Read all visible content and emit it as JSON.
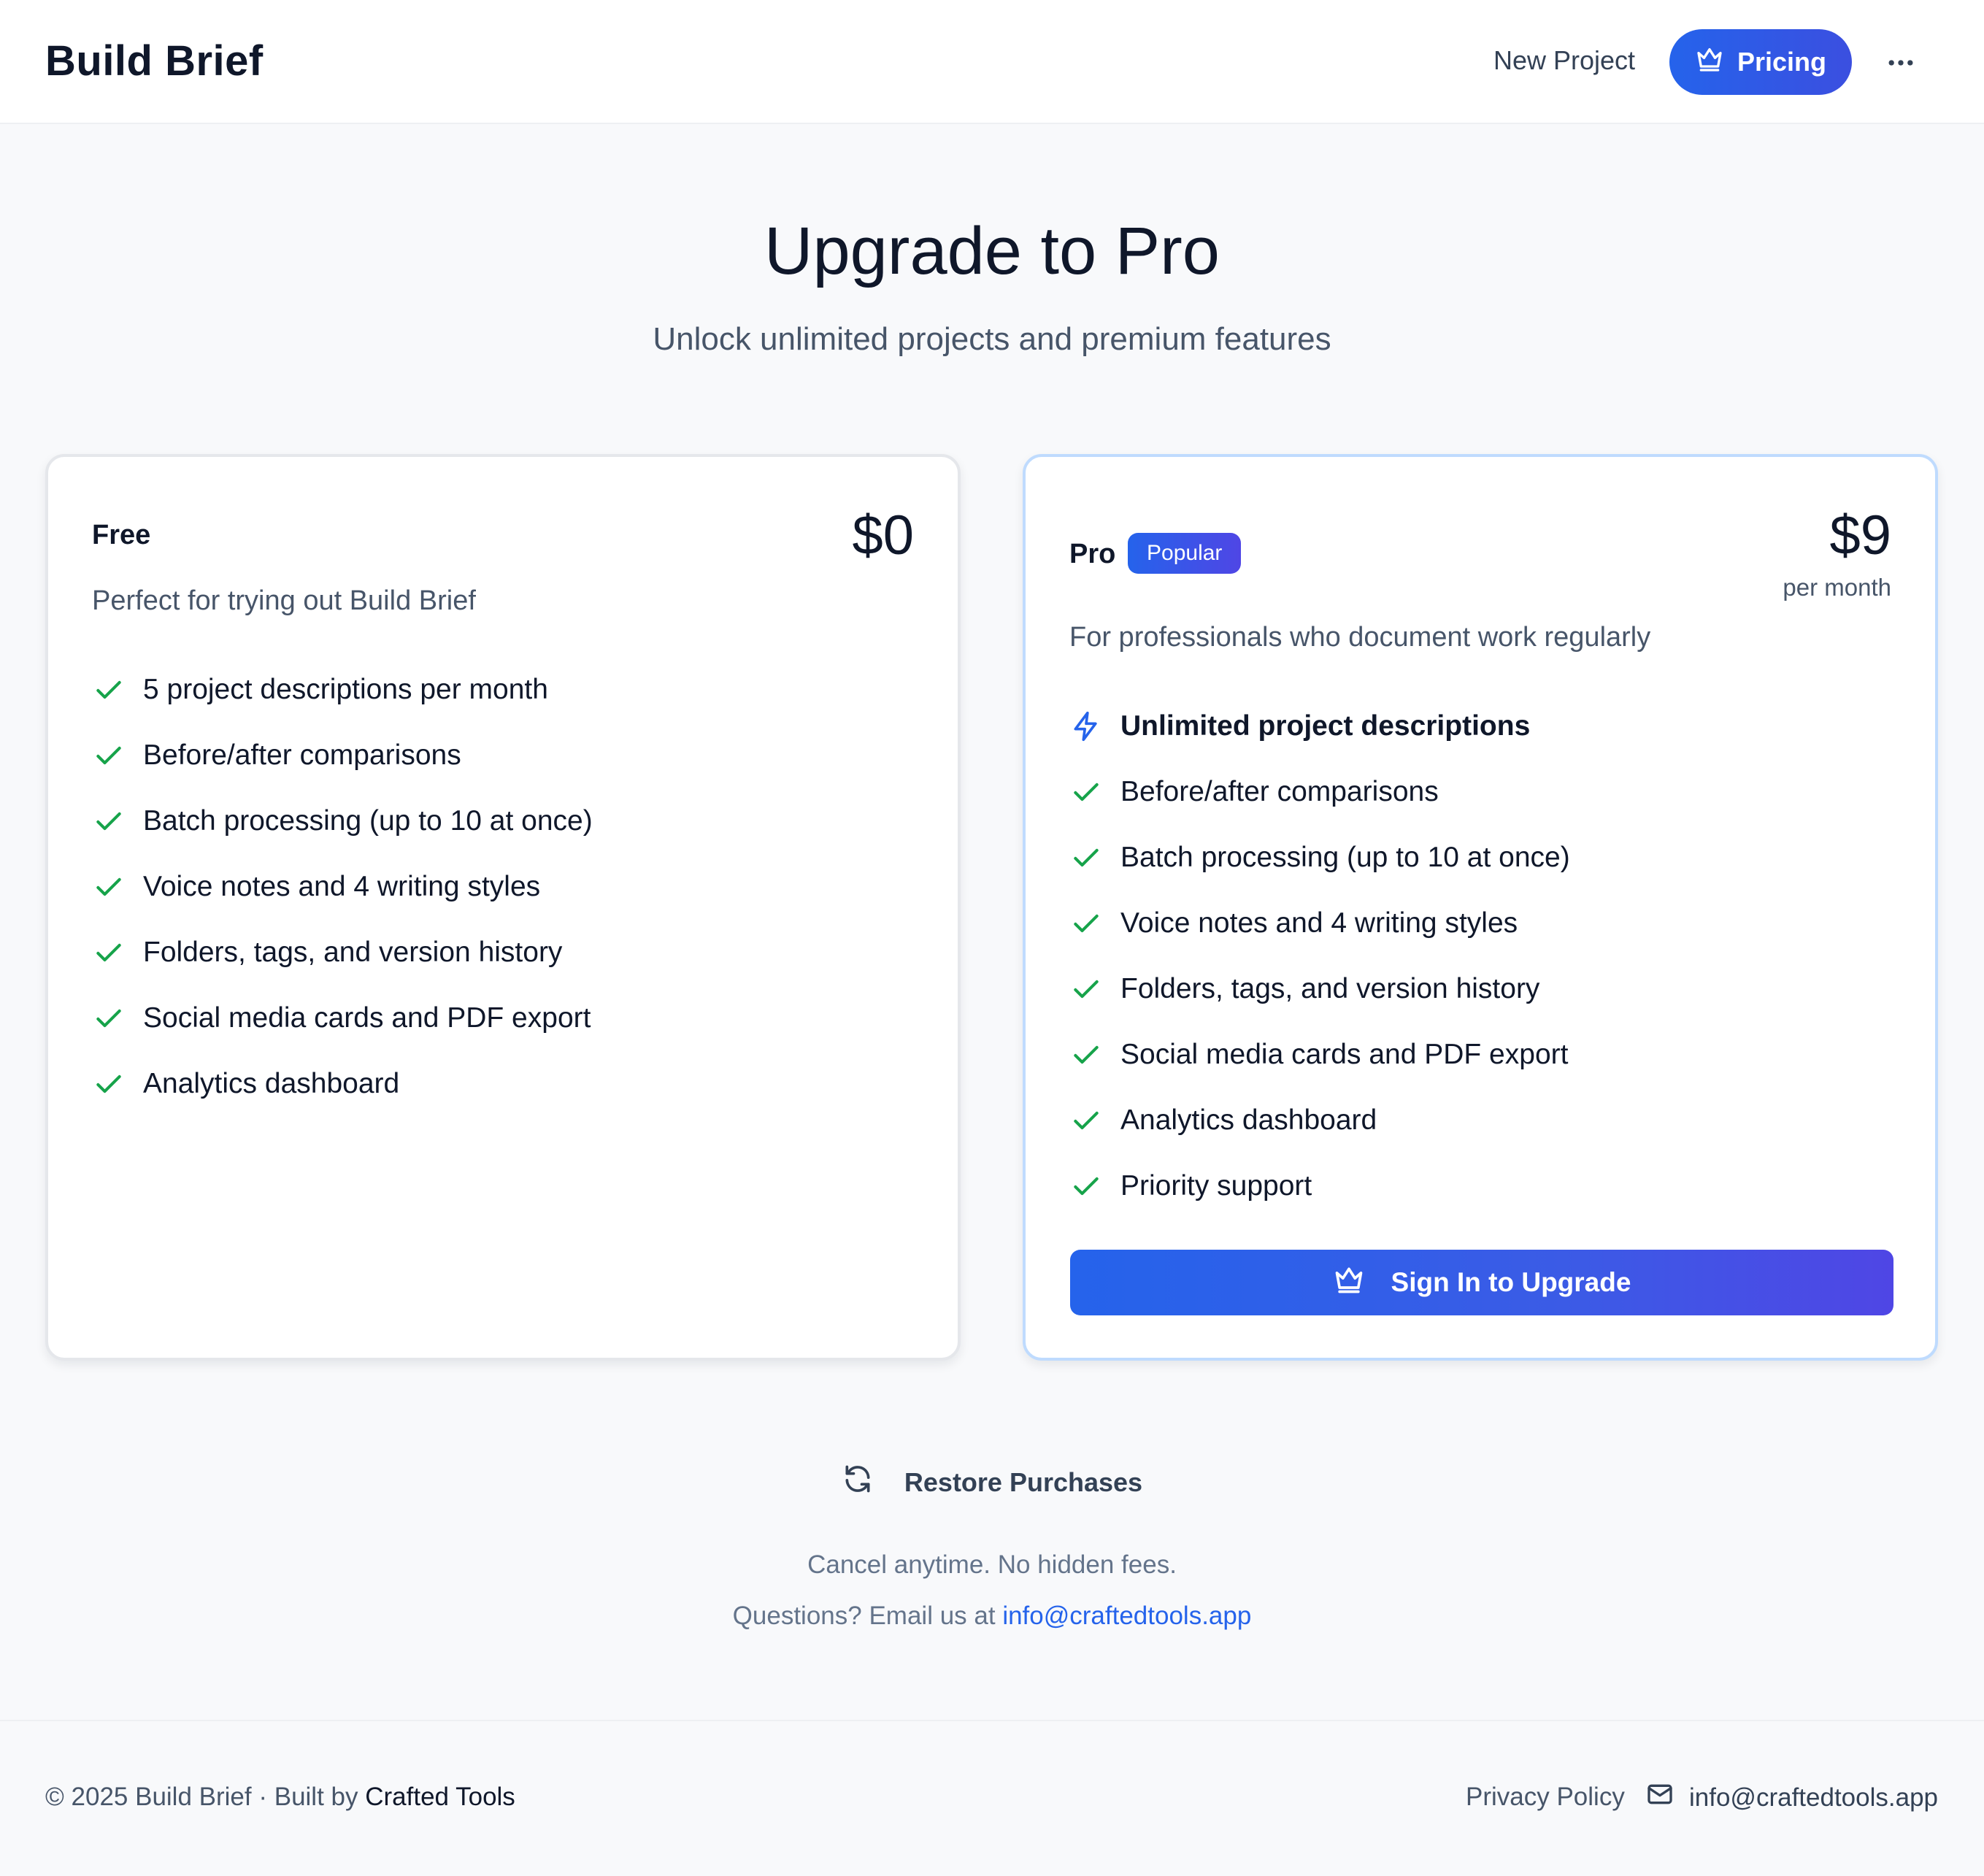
{
  "header": {
    "brand": "Build Brief",
    "nav_new_project": "New Project",
    "nav_pricing": "Pricing",
    "more_icon": "more-horizontal-icon"
  },
  "hero": {
    "title": "Upgrade to Pro",
    "subtitle": "Unlock unlimited projects and premium features"
  },
  "plans": {
    "free": {
      "name": "Free",
      "price": "$0",
      "description": "Perfect for trying out Build Brief",
      "features": [
        "5 project descriptions per month",
        "Before/after comparisons",
        "Batch processing (up to 10 at once)",
        "Voice notes and 4 writing styles",
        "Folders, tags, and version history",
        "Social media cards and PDF export",
        "Analytics dashboard"
      ]
    },
    "pro": {
      "name": "Pro",
      "badge": "Popular",
      "price": "$9",
      "period": "per month",
      "description": "For professionals who document work regularly",
      "features": [
        "Unlimited project descriptions",
        "Before/after comparisons",
        "Batch processing (up to 10 at once)",
        "Voice notes and 4 writing styles",
        "Folders, tags, and version history",
        "Social media cards and PDF export",
        "Analytics dashboard",
        "Priority support"
      ],
      "cta": "Sign In to Upgrade"
    }
  },
  "restore": "Restore Purchases",
  "notes": {
    "cancel": "Cancel anytime. No hidden fees.",
    "questions_prefix": "Questions? Email us at",
    "email": "info@craftedtools.app"
  },
  "footer": {
    "copyright_prefix": "© 2025 Build Brief · Built by",
    "maker": "Crafted Tools",
    "privacy": "Privacy Policy",
    "email": "info@craftedtools.app"
  },
  "colors": {
    "accent": "#2563eb",
    "accent_end": "#4f46e5",
    "check": "#16a34a",
    "pro_border": "#bfdbfe"
  },
  "icons": {
    "pricing": "crown-icon",
    "check": "check-icon",
    "unlimited": "lightning-icon",
    "cta": "crown-icon",
    "restore": "refresh-icon",
    "footer_email": "mail-icon"
  }
}
